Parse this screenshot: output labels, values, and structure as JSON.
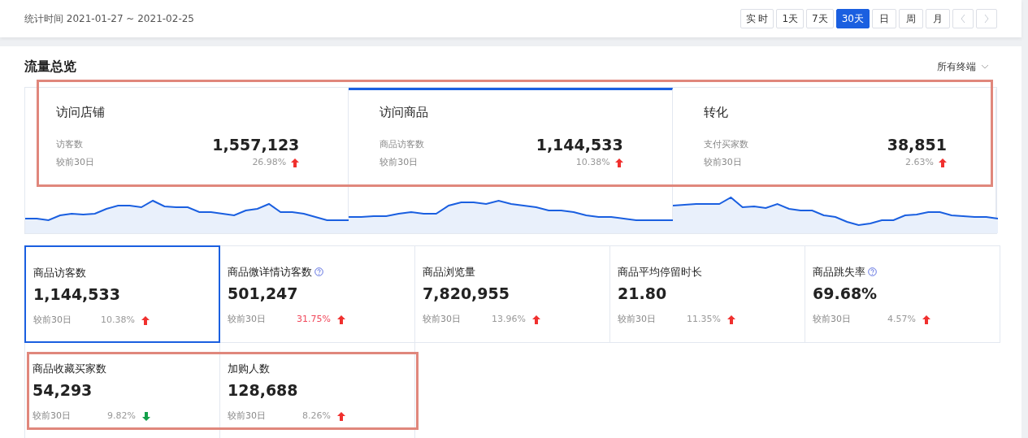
{
  "header": {
    "period_label": "统计时间 2021-01-27 ~ 2021-02-25",
    "ranges": [
      {
        "label": "实 时",
        "selected": false
      },
      {
        "label": "1天",
        "selected": false
      },
      {
        "label": "7天",
        "selected": false
      },
      {
        "label": "30天",
        "selected": true
      },
      {
        "label": "日",
        "selected": false
      },
      {
        "label": "周",
        "selected": false
      },
      {
        "label": "月",
        "selected": false
      }
    ],
    "pager": [
      {
        "kind": "prev",
        "disabled": true
      },
      {
        "kind": "next",
        "disabled": true
      }
    ]
  },
  "panel": {
    "title": "流量总览",
    "terminal_filter": "所有终端"
  },
  "overview": {
    "highlighted": true,
    "cards": [
      {
        "title": "访问店铺",
        "metric": "访客数",
        "value": "1,557,123",
        "compare": "较前30日",
        "change": "26.98%",
        "rising": true,
        "selected": false
      },
      {
        "title": "访问商品",
        "metric": "商品访客数",
        "value": "1,144,533",
        "compare": "较前30日",
        "change": "10.38%",
        "rising": true,
        "selected": true
      },
      {
        "title": "转化",
        "metric": "支付买家数",
        "value": "38,851",
        "compare": "较前30日",
        "change": "2.63%",
        "rising": true,
        "selected": false
      }
    ]
  },
  "metric_rows": [
    {
      "metrics": [
        {
          "label": "商品访客数",
          "help": false,
          "value": "1,144,533",
          "compare": "较前30日",
          "change": "10.38%",
          "emphasized": false,
          "rising": true,
          "selected": true
        },
        {
          "label": "商品微详情访客数",
          "help": true,
          "value": "501,247",
          "compare": "较前30日",
          "change": "31.75%",
          "emphasized": true,
          "rising": true,
          "selected": false
        },
        {
          "label": "商品浏览量",
          "help": false,
          "value": "7,820,955",
          "compare": "较前30日",
          "change": "13.96%",
          "emphasized": false,
          "rising": true,
          "selected": false
        },
        {
          "label": "商品平均停留时长",
          "help": false,
          "value": "21.80",
          "compare": "较前30日",
          "change": "11.35%",
          "emphasized": false,
          "rising": true,
          "selected": false
        },
        {
          "label": "商品跳失率",
          "help": true,
          "value": "69.68%",
          "compare": "较前30日",
          "change": "4.57%",
          "emphasized": false,
          "rising": true,
          "selected": false
        }
      ]
    },
    {
      "highlighted": true,
      "metrics": [
        {
          "label": "商品收藏买家数",
          "help": false,
          "value": "54,293",
          "compare": "较前30日",
          "change": "9.82%",
          "emphasized": false,
          "rising": false,
          "selected": false
        },
        {
          "label": "加购人数",
          "help": false,
          "value": "128,688",
          "compare": "较前30日",
          "change": "8.26%",
          "emphasized": false,
          "rising": true,
          "selected": false
        }
      ]
    }
  ]
}
